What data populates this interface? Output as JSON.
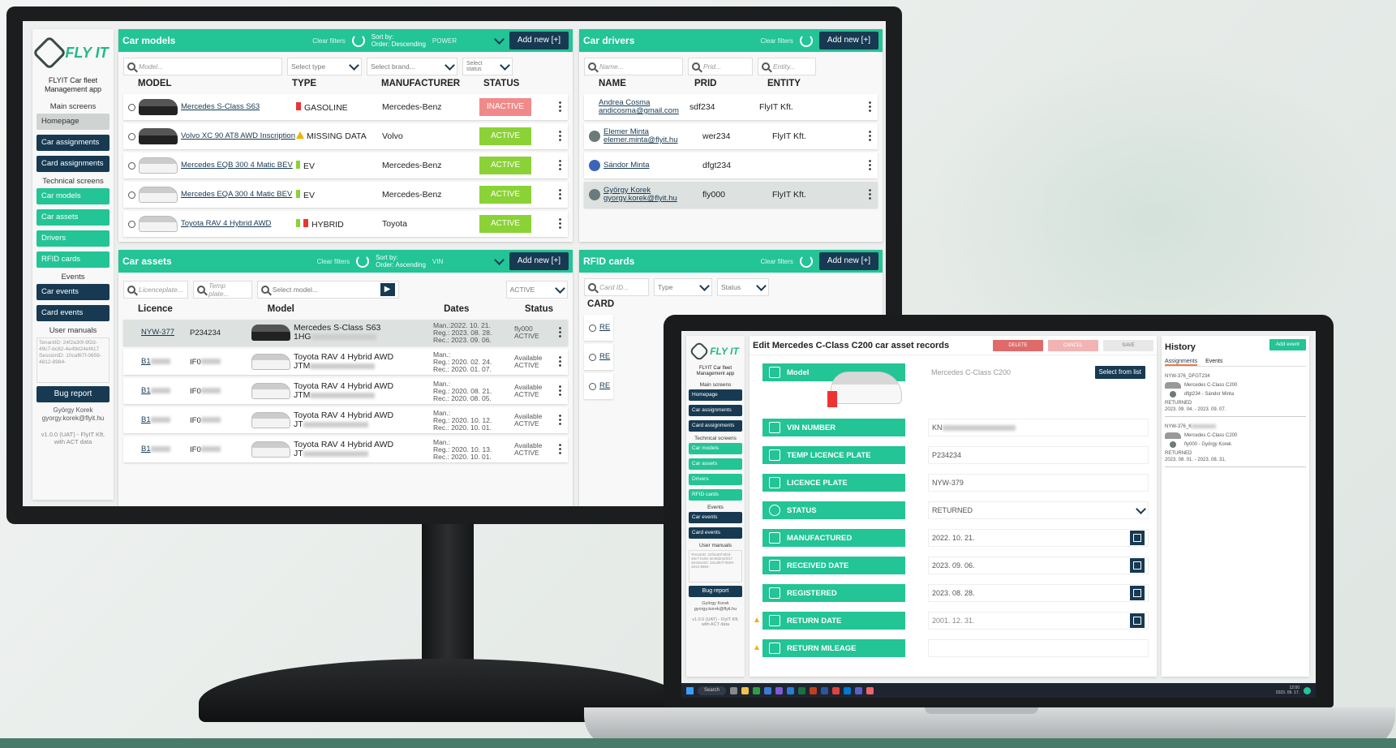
{
  "sidebar": {
    "logo_text": "FLY IT",
    "app_name": "FLYIT Car fleet Management app",
    "main_label": "Main screens",
    "main_items": [
      "Homepage",
      "Car assignments",
      "Card assignments"
    ],
    "technical_label": "Technical screens",
    "technical_items": [
      "Car models",
      "Car assets",
      "Drivers",
      "RFID cards"
    ],
    "events_label": "Events",
    "event_items": [
      "Car events",
      "Card events"
    ],
    "manuals_label": "User manuals",
    "session_text": "TenantID: 24f2a30f-9f2d-49c7-bc82-4e49d24ef417 SessionID: 10caf67f-0659-4812-8984-",
    "bug_report": "Bug report",
    "user_name": "György Korek",
    "user_email": "gyorgy.korek@flyit.hu",
    "version": "v1.0.0 (UAT) - FlyIT Kft. with ACT data"
  },
  "car_models": {
    "title": "Car models",
    "clear_filters": "Clear filters",
    "sort_by": "Sort by:",
    "sort_order": "Order: Descending",
    "sort_value": "POWER",
    "add_new": "Add new [+]",
    "filter_model": "Model...",
    "filter_type": "Select type",
    "filter_brand": "Select brand...",
    "filter_status": "Select status",
    "headers": [
      "MODEL",
      "TYPE",
      "MANUFACTURER",
      "STATUS"
    ],
    "rows": [
      {
        "model": "Mercedes S-Class S63",
        "type": "GASOLINE",
        "manufacturer": "Mercedes-Benz",
        "status": "INACTIVE"
      },
      {
        "model": "Volvo XC 90 AT8 AWD Inscription",
        "type": "MISSING DATA",
        "manufacturer": "Volvo",
        "status": "ACTIVE"
      },
      {
        "model": "Mercedes EQB 300 4 Matic BEV",
        "type": "EV",
        "manufacturer": "Mercedes-Benz",
        "status": "ACTIVE"
      },
      {
        "model": "Mercedes EQA 300 4 Matic BEV",
        "type": "EV",
        "manufacturer": "Mercedes-Benz",
        "status": "ACTIVE"
      },
      {
        "model": "Toyota RAV 4 Hybrid AWD",
        "type": "HYBRID",
        "manufacturer": "Toyota",
        "status": "ACTIVE"
      }
    ]
  },
  "car_drivers": {
    "title": "Car drivers",
    "clear_filters": "Clear filters",
    "add_new": "Add new [+]",
    "filter_name": "Name...",
    "filter_prid": "Prid...",
    "filter_entity": "Entity...",
    "headers": [
      "NAME",
      "PRID",
      "ENTITY"
    ],
    "rows": [
      {
        "name": "Andrea Cosma",
        "email": "andicosma@gmail.com",
        "prid": "sdf234",
        "entity": "FlyIT Kft."
      },
      {
        "name": "Elemer Minta",
        "email": "elemer.minta@flyit.hu",
        "prid": "wer234",
        "entity": "FlyIT Kft."
      },
      {
        "name": "Sándor Minta",
        "email": "",
        "prid": "dfgt234",
        "entity": ""
      },
      {
        "name": "György Korek",
        "email": "gyorgy.korek@flyit.hu",
        "prid": "fly000",
        "entity": "FlyIT Kft."
      }
    ]
  },
  "car_assets": {
    "title": "Car assets",
    "clear_filters": "Clear filters",
    "sort_by": "Sort by:",
    "sort_order": "Order: Ascending",
    "sort_value": "VIN",
    "add_new": "Add new [+]",
    "filter_licence": "Licenceplate...",
    "filter_temp": "Temp plate...",
    "filter_model": "Select model...",
    "filter_status": "ACTIVE",
    "headers": [
      "Licence",
      "Model",
      "Dates",
      "Status"
    ],
    "rows": [
      {
        "licence": "NYW-377",
        "temp": "P234234",
        "model": "Mercedes S-Class S63",
        "model2": "1HG",
        "dates": [
          "Man.:2022. 10. 21.",
          "Reg.: 2023. 08. 28.",
          "Rec.: 2023. 09. 06."
        ],
        "status": "fly000",
        "status2": "ACTIVE"
      },
      {
        "licence": "B1",
        "temp": "IF0",
        "model": "Toyota RAV 4 Hybrid AWD",
        "model2": "JTM",
        "dates": [
          "Man.:",
          "Reg.: 2020. 02. 24.",
          "Rec.: 2020. 01. 07."
        ],
        "status": "Available",
        "status2": "ACTIVE"
      },
      {
        "licence": "B1",
        "temp": "IF0",
        "model": "Toyota RAV 4 Hybrid AWD",
        "model2": "JTM",
        "dates": [
          "Man.:",
          "Reg.: 2020. 08. 21.",
          "Rec.: 2020. 08. 05."
        ],
        "status": "Available",
        "status2": "ACTIVE"
      },
      {
        "licence": "B1",
        "temp": "IF0",
        "model": "Toyota RAV 4 Hybrid AWD",
        "model2": "JT",
        "dates": [
          "Man.:",
          "Reg.: 2020. 10. 12.",
          "Rec.: 2020. 10. 01."
        ],
        "status": "Available",
        "status2": "ACTIVE"
      },
      {
        "licence": "B1",
        "temp": "IF0",
        "model": "Toyota RAV 4 Hybrid AWD",
        "model2": "JT",
        "dates": [
          "Man.:",
          "Reg.: 2020. 10. 13.",
          "Rec.: 2020. 10. 01."
        ],
        "status": "Available",
        "status2": "ACTIVE"
      }
    ]
  },
  "rfid_cards": {
    "title": "RFID cards",
    "clear_filters": "Clear filters",
    "add_new": "Add new [+]",
    "filter_card": "Card ID...",
    "filter_type": "Type",
    "filter_status": "Status",
    "header": "CARD",
    "rows": [
      "RE",
      "RE",
      "RE"
    ]
  },
  "edit_panel": {
    "title": "Edit Mercedes C-Class C200 car asset records",
    "delete": "DELETE",
    "cancel": "CANCEL",
    "save": "SAVE",
    "select_from_list": "Select from list",
    "fields": [
      {
        "label": "Model",
        "value": "Mercedes C-Class C200"
      },
      {
        "label": "VIN NUMBER",
        "value": "KN"
      },
      {
        "label": "TEMP LICENCE PLATE",
        "value": "P234234"
      },
      {
        "label": "LICENCE PLATE",
        "value": "NYW-379"
      },
      {
        "label": "STATUS",
        "value": "RETURNED"
      },
      {
        "label": "MANUFACTURED",
        "value": "2022. 10. 21."
      },
      {
        "label": "RECEIVED DATE",
        "value": "2023. 09. 06."
      },
      {
        "label": "REGISTERED",
        "value": "2023. 08. 28."
      },
      {
        "label": "RETURN DATE",
        "value": "2001. 12. 31."
      },
      {
        "label": "RETURN MILEAGE",
        "value": ""
      }
    ]
  },
  "history": {
    "title": "History",
    "add_event": "Add event",
    "tabs": [
      "Assignments",
      "Events"
    ],
    "entries": [
      {
        "id": "NYW-376_DFGT234",
        "car": "Mercedes C-Class C200",
        "driver": "dfgt234 - Sándor Minta",
        "status": "RETURNED",
        "range": "2023. 09. 04. - 2023. 09. 07."
      },
      {
        "id": "NYW-376_K",
        "car": "Mercedes C-Class C200",
        "driver": "fly000 - György Korek",
        "status": "RETURNED",
        "range": "2023. 08. 01. - 2023. 08. 31."
      }
    ]
  },
  "taskbar": {
    "search": "Search",
    "time": "12:00",
    "date": "2023. 09. 17."
  }
}
